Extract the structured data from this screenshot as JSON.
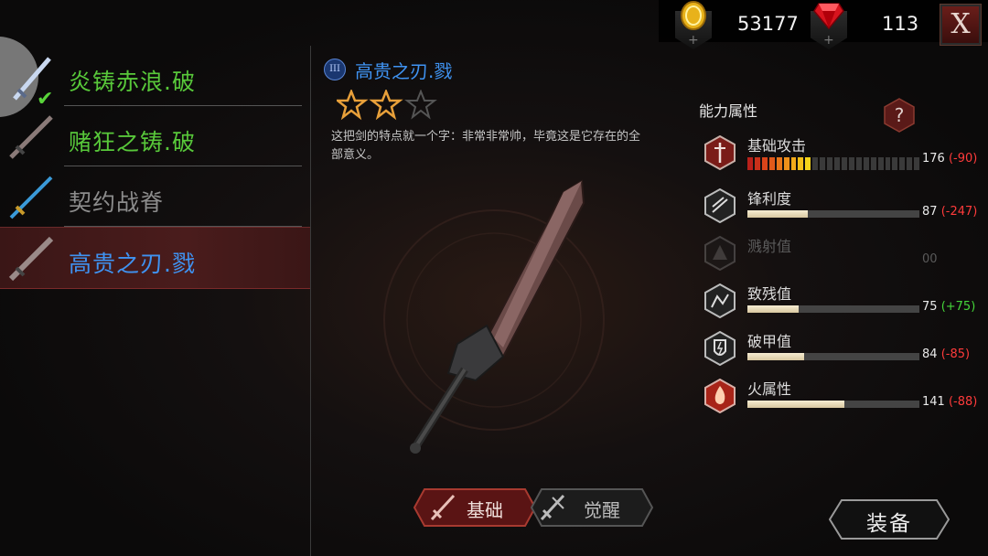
{
  "currency": {
    "coins": "53177",
    "gems": "113",
    "coin_icon": "gold-coin-icon",
    "gem_icon": "red-gem-icon"
  },
  "close_label": "X",
  "weapons": [
    {
      "name": "炎铸赤浪.破",
      "color": "#58c83a",
      "equipped": true
    },
    {
      "name": "赌狂之铸.破",
      "color": "#58c83a",
      "equipped": false
    },
    {
      "name": "契约战脊",
      "color": "#8c8c8c",
      "equipped": false
    },
    {
      "name": "高贵之刃.戮",
      "color": "#3f93f2",
      "equipped": false
    }
  ],
  "selected": {
    "tier": "III",
    "title": "高贵之刃.戮",
    "stars_filled": 2,
    "stars_total": 3,
    "description": "这把剑的特点就一个字：非常非常帅，毕竟这是它存在的全部意义。"
  },
  "tabs": {
    "basic": "基础",
    "awaken": "觉醒"
  },
  "equip_label": "装备",
  "stats": {
    "title": "能力属性",
    "help": "?",
    "items": [
      {
        "name": "基础攻击",
        "value": "176",
        "delta": "(-90)",
        "delta_color": "#ff3b3b",
        "fill": 0.36,
        "icon": "attack-icon",
        "segmented": true,
        "active": true
      },
      {
        "name": "锋利度",
        "value": "87",
        "delta": "(-247)",
        "delta_color": "#ff3b3b",
        "fill": 0.35,
        "icon": "sharpness-icon",
        "segmented": false,
        "active": true
      },
      {
        "name": "溅射值",
        "value": "00",
        "delta": "",
        "delta_color": "#ff3b3b",
        "fill": 0,
        "icon": "splash-icon",
        "segmented": false,
        "active": false
      },
      {
        "name": "致残值",
        "value": "75",
        "delta": "(+75)",
        "delta_color": "#45d63a",
        "fill": 0.3,
        "icon": "cripple-icon",
        "segmented": false,
        "active": true
      },
      {
        "name": "破甲值",
        "value": "84",
        "delta": "(-85)",
        "delta_color": "#ff3b3b",
        "fill": 0.33,
        "icon": "armor-break-icon",
        "segmented": false,
        "active": true
      },
      {
        "name": "火属性",
        "value": "141",
        "delta": "(-88)",
        "delta_color": "#ff3b3b",
        "fill": 0.565,
        "icon": "fire-icon",
        "segmented": false,
        "active": true
      }
    ]
  }
}
